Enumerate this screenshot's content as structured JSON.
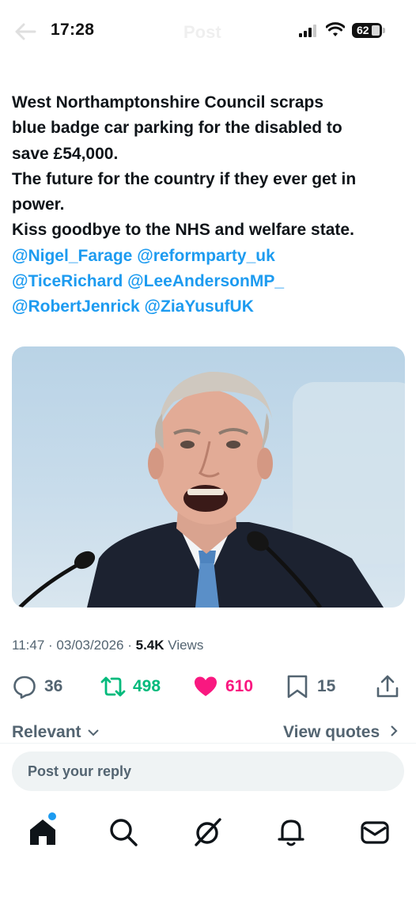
{
  "status_bar": {
    "time": "17:28",
    "header_title": "Post",
    "battery": "62"
  },
  "post": {
    "text_lines": [
      "West  Northamptonshire Council scraps",
      "blue badge car parking for the disabled to",
      "save £54,000.",
      "The future for the country if they ever get in",
      "power.",
      "Kiss goodbye to the NHS and welfare state."
    ],
    "mentions": [
      [
        "@Nigel_Farage",
        "@reformparty_uk"
      ],
      [
        "@TiceRichard",
        "@LeeAndersonMP_"
      ],
      [
        "@RobertJenrick",
        "@ZiaYusufUK"
      ]
    ],
    "meta": {
      "time": "11:47",
      "date": "03/03/2026",
      "views_count": "5.4K",
      "views_label": "Views"
    },
    "actions": {
      "replies": "36",
      "reposts": "498",
      "likes": "610",
      "bookmarks": "15"
    }
  },
  "tabs": {
    "relevant": "Relevant",
    "quotes": "View quotes"
  },
  "reply": {
    "placeholder": "Post your reply"
  },
  "colors": {
    "accent": "#1d9bf0",
    "repost": "#00ba7c",
    "like": "#f91880",
    "muted": "#536471"
  },
  "icons": [
    "back-arrow-icon",
    "signal-icon",
    "wifi-icon",
    "battery-icon",
    "reply-icon",
    "repost-icon",
    "like-icon",
    "bookmark-icon",
    "share-icon",
    "chevron-down-icon",
    "chevron-right-icon",
    "home-icon",
    "search-icon",
    "grok-icon",
    "notifications-icon",
    "messages-icon"
  ]
}
